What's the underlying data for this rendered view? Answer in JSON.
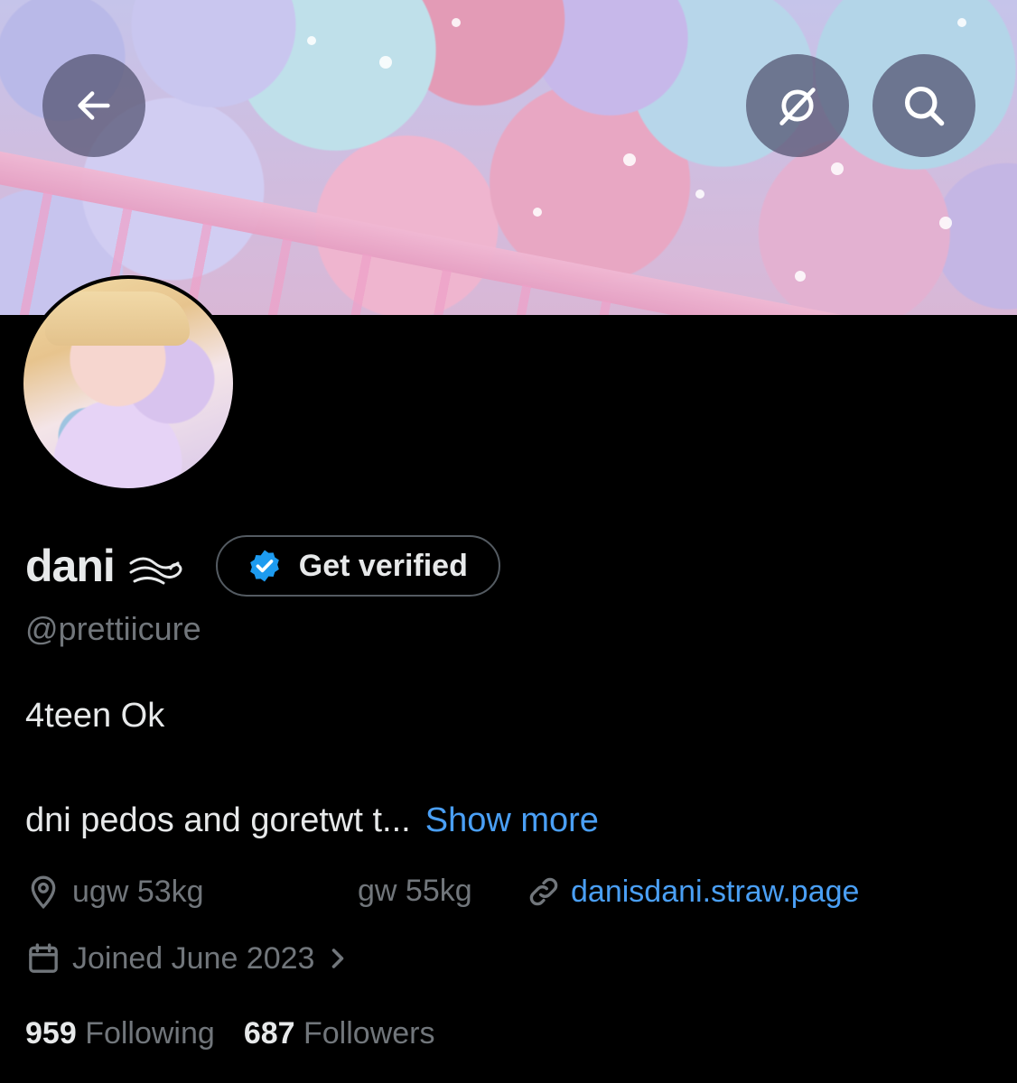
{
  "header": {
    "back_icon": "arrow-left-icon",
    "grok_icon": "grok-icon",
    "search_icon": "search-icon"
  },
  "profile": {
    "name": "dani",
    "name_emoji_icon": "wind-swirl-icon",
    "verify_button_label": "Get verified",
    "handle": "@prettiicure",
    "bio_line1": "4teen Ok",
    "bio_line2": "dni pedos and goretwt t...",
    "show_more": "Show more",
    "location": "ugw 53kg",
    "extra": "gw 55kg",
    "website": "danisdani.straw.page",
    "joined": "Joined June 2023",
    "following_count": "959",
    "following_label": "Following",
    "followers_count": "687",
    "followers_label": "Followers"
  },
  "colors": {
    "background": "#000000",
    "text_primary": "#e7e9ea",
    "text_secondary": "#71767b",
    "link": "#4a9ff5",
    "verified_badge": "#1d9bf0"
  }
}
